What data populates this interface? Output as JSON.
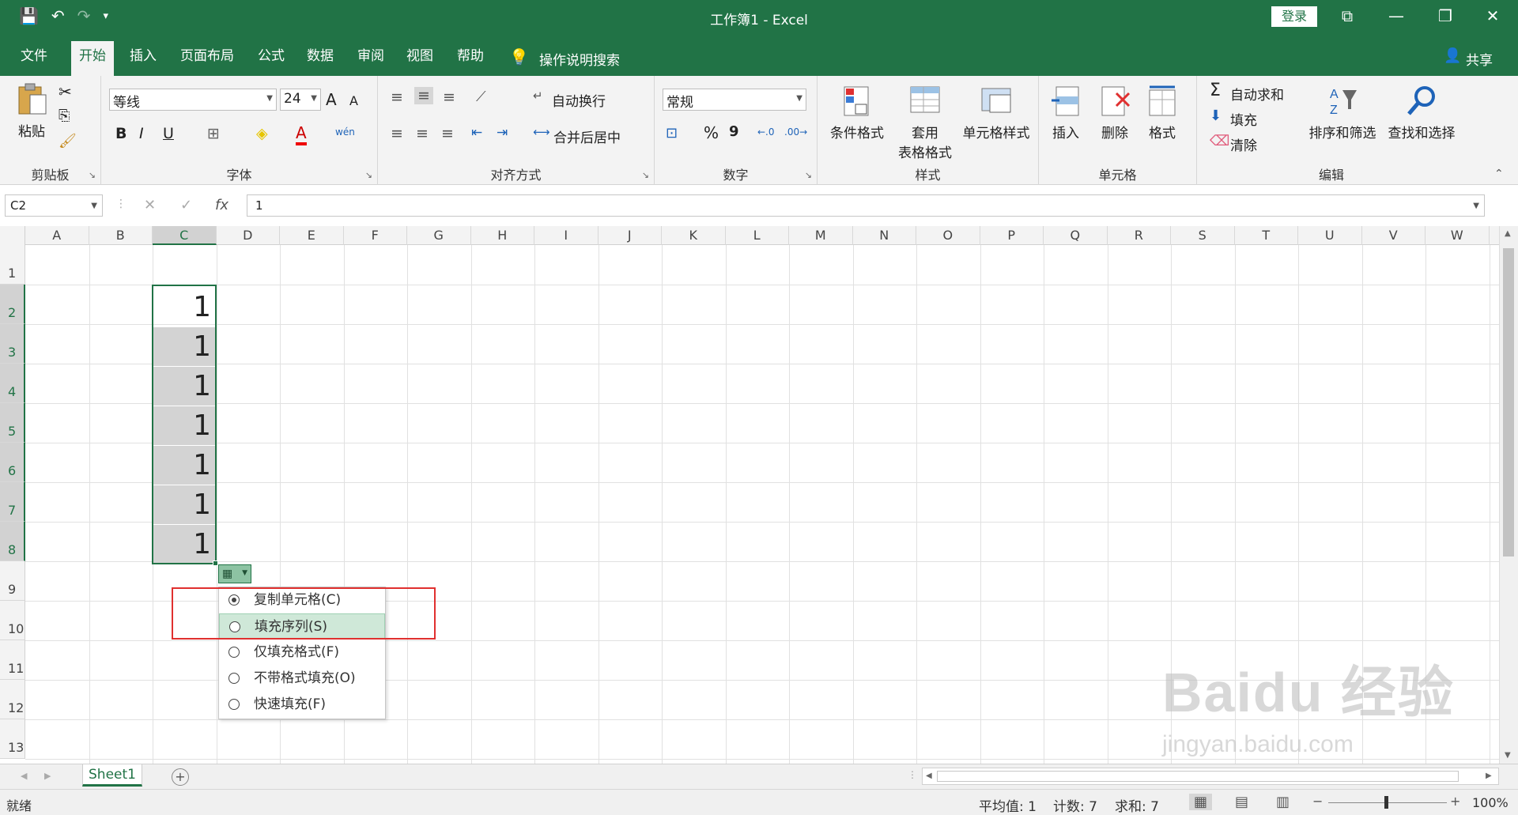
{
  "titlebar": {
    "title": "工作簿1  -  Excel",
    "login": "登录",
    "qat": {
      "save": "💾",
      "undo": "↶",
      "redo": "↷",
      "customize": "▾"
    },
    "win": {
      "ribbon_display": "⧉",
      "minimize": "—",
      "restore": "❐",
      "close": "✕"
    }
  },
  "tabs": [
    {
      "label": "文件"
    },
    {
      "label": "开始"
    },
    {
      "label": "插入"
    },
    {
      "label": "页面布局"
    },
    {
      "label": "公式"
    },
    {
      "label": "数据"
    },
    {
      "label": "审阅"
    },
    {
      "label": "视图"
    },
    {
      "label": "帮助"
    }
  ],
  "tellme": "操作说明搜索",
  "share": "共享",
  "ribbon": {
    "clipboard": {
      "label": "剪贴板",
      "paste": "粘贴"
    },
    "font": {
      "label": "字体",
      "name": "等线",
      "size": "24",
      "bold": "B",
      "italic": "I",
      "underline": "U",
      "grow": "A",
      "shrink": "A",
      "fontcolor": "A",
      "phonetic": "wén"
    },
    "alignment": {
      "label": "对齐方式",
      "wrap": "自动换行",
      "merge": "合并后居中"
    },
    "number": {
      "label": "数字",
      "format": "常规",
      "percent": "%",
      "comma": "9"
    },
    "styles": {
      "label": "样式",
      "conditional": "条件格式",
      "table": "套用",
      "table2": "表格格式",
      "cellstyles": "单元格样式"
    },
    "cells": {
      "label": "单元格",
      "insert": "插入",
      "delete": "删除",
      "format": "格式"
    },
    "editing": {
      "label": "编辑",
      "autosum": "自动求和",
      "fill": "填充",
      "clear": "清除",
      "sort": "排序和筛选",
      "find": "查找和选择"
    }
  },
  "formula": {
    "namebox": "C2",
    "value": "1",
    "cancel": "✕",
    "enter": "✓",
    "fx": "fx"
  },
  "columns": [
    "A",
    "B",
    "C",
    "D",
    "E",
    "F",
    "G",
    "H",
    "I",
    "J",
    "K",
    "L",
    "M",
    "N",
    "O",
    "P",
    "Q",
    "R",
    "S",
    "T",
    "U",
    "V",
    "W"
  ],
  "rows": [
    "1",
    "2",
    "3",
    "4",
    "5",
    "6",
    "7",
    "8",
    "9",
    "10",
    "11",
    "12",
    "13"
  ],
  "cells": {
    "c2": "1",
    "c3": "1",
    "c4": "1",
    "c5": "1",
    "c6": "1",
    "c7": "1",
    "c8": "1"
  },
  "autofill_menu": {
    "items": [
      {
        "label": "复制单元格(C)",
        "selected": true
      },
      {
        "label": "填充序列(S)",
        "selected": false
      },
      {
        "label": "仅填充格式(F)",
        "selected": false
      },
      {
        "label": "不带格式填充(O)",
        "selected": false
      },
      {
        "label": "快速填充(F)",
        "selected": false
      }
    ]
  },
  "sheet": {
    "name": "Sheet1",
    "add": "+"
  },
  "status": {
    "ready": "就绪",
    "average": "平均值: 1",
    "count": "计数: 7",
    "sum": "求和: 7",
    "zoom": "100%",
    "zoom_out": "−",
    "zoom_in": "+"
  },
  "watermark": {
    "line1": "Baidu 经验",
    "line2": "jingyan.baidu.com"
  },
  "colors": {
    "accent": "#217346",
    "highlight": "#e0302f",
    "fill_selection": "#d3d3d3"
  }
}
